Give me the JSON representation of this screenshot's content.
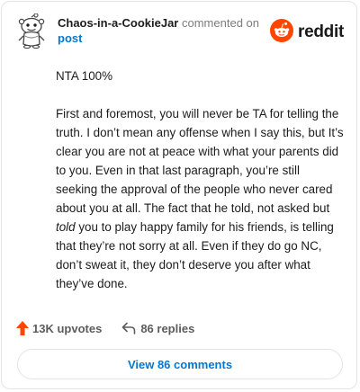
{
  "header": {
    "username": "Chaos-in-a-CookieJar",
    "action_text": "commented on",
    "link_text": "post",
    "brand": "reddit",
    "avatar_icon": "snoo-avatar-icon",
    "brand_icon": "reddit-logo-icon",
    "brand_color": "#ff4500"
  },
  "comment": {
    "line1": "NTA 100%",
    "para_a": "First and foremost, you will never be TA for telling the truth. I don’t mean any offense when I say this, but It’s clear you are not at peace with what your parents did to you. Even in that last paragraph, you’re still seeking the approval of the people who never cared about you at all. The fact that he told, not asked but ",
    "emphasis": "told",
    "para_b": " you to play happy family for his friends, is telling that they’re not sorry at all. Even if they do go NC, don’t sweat it, they don’t deserve you after what they’ve done."
  },
  "actions": {
    "upvotes_label": "13K upvotes",
    "replies_label": "86 replies",
    "upvote_icon": "upvote-arrow-icon",
    "reply_icon": "reply-arrow-icon",
    "upvote_color": "#ff4500"
  },
  "footer": {
    "view_label": "View 86 comments"
  }
}
